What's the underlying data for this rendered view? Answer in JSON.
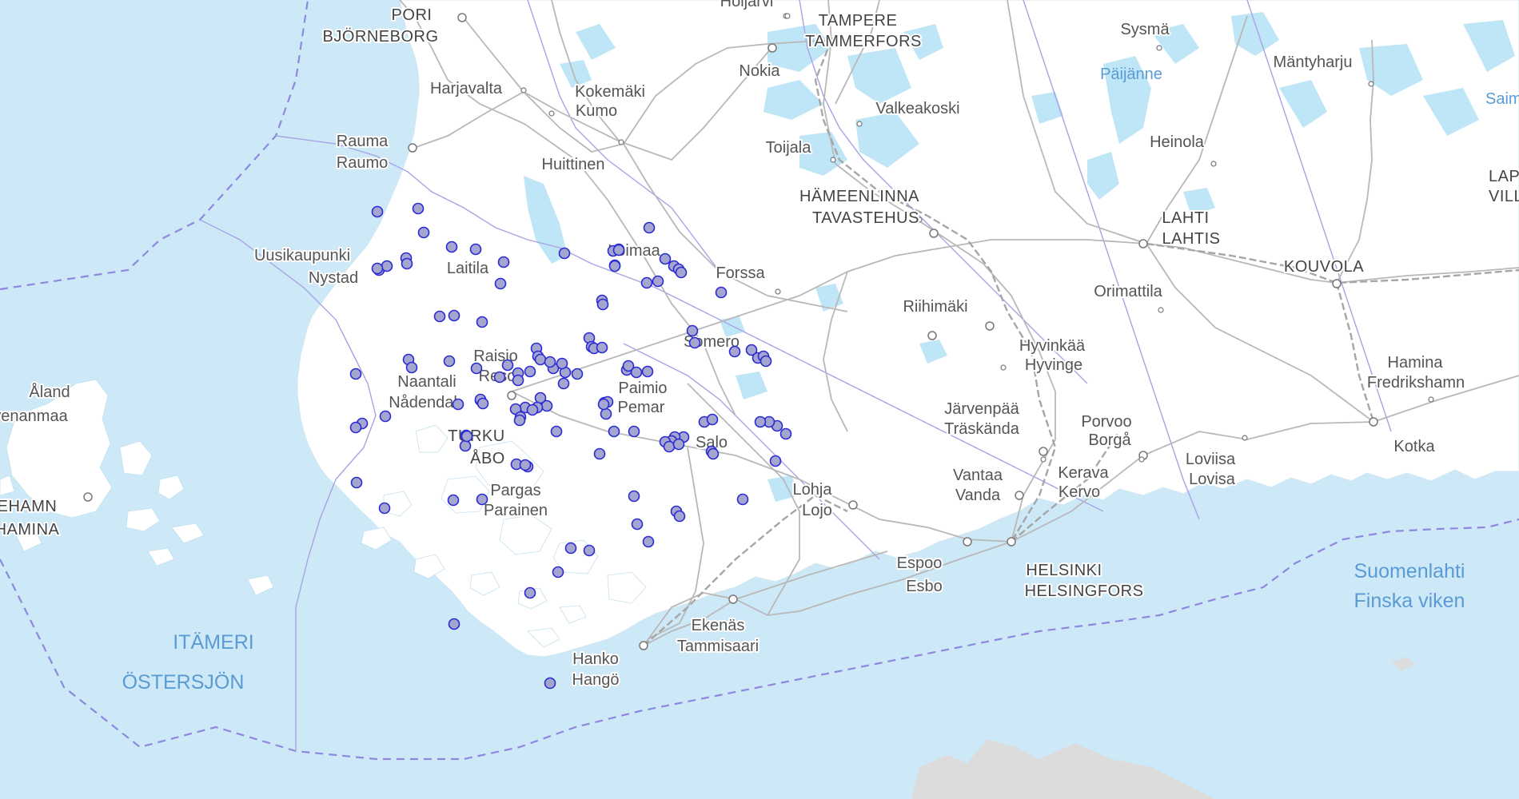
{
  "map": {
    "colors": {
      "sea": "#cde9f7",
      "land": "#ffffff",
      "lake": "#bfe6f7",
      "road": "#b8b8b8",
      "border": "#a9a2e3",
      "dash": "#8e87e0",
      "marker_fill": "#a4a6cf",
      "marker_stroke": "#2a2ad6",
      "foreign": "#dcdcdc"
    },
    "places": [
      {
        "key": "pori",
        "text": "PORI"
      },
      {
        "key": "bjorneborg",
        "text": "BJÖRNEBORG"
      },
      {
        "key": "harjavalta",
        "text": "Harjavalta"
      },
      {
        "key": "kokemaki",
        "text": "Kokemäki"
      },
      {
        "key": "kumo",
        "text": "Kumo"
      },
      {
        "key": "rauma",
        "text": "Rauma"
      },
      {
        "key": "raumo",
        "text": "Raumo"
      },
      {
        "key": "huittinen",
        "text": "Huittinen"
      },
      {
        "key": "uusikaupunki",
        "text": "Uusikaupunki"
      },
      {
        "key": "nystad",
        "text": "Nystad"
      },
      {
        "key": "laitila",
        "text": "Laitila"
      },
      {
        "key": "loimaa",
        "text": "Loimaa"
      },
      {
        "key": "forssa",
        "text": "Forssa"
      },
      {
        "key": "raisio",
        "text": "Raisio"
      },
      {
        "key": "reso",
        "text": "Reso"
      },
      {
        "key": "naantali",
        "text": "Naantali"
      },
      {
        "key": "nadendal",
        "text": "Nådendal"
      },
      {
        "key": "turku",
        "text": "TURKU"
      },
      {
        "key": "abo",
        "text": "ÅBO"
      },
      {
        "key": "paimio",
        "text": "Paimio"
      },
      {
        "key": "pemar",
        "text": "Pemar"
      },
      {
        "key": "somero",
        "text": "Somero"
      },
      {
        "key": "salo",
        "text": "Salo"
      },
      {
        "key": "pargas",
        "text": "Pargas"
      },
      {
        "key": "parainen",
        "text": "Parainen"
      },
      {
        "key": "aland",
        "text": "Åland"
      },
      {
        "key": "ahvenanmaa",
        "text": "venanmaa"
      },
      {
        "key": "mariehamn",
        "text": "EHAMN"
      },
      {
        "key": "maarianhamina",
        "text": "HAMINA"
      },
      {
        "key": "tampere",
        "text": "TAMPERE"
      },
      {
        "key": "tammerfors",
        "text": "TAMMERFORS"
      },
      {
        "key": "nokia",
        "text": "Nokia"
      },
      {
        "key": "valkeakoski",
        "text": "Valkeakoski"
      },
      {
        "key": "toijala",
        "text": "Toijala"
      },
      {
        "key": "hameenlinna",
        "text": "HÄMEENLINNA"
      },
      {
        "key": "tavastehus",
        "text": "TAVASTEHUS"
      },
      {
        "key": "riihimaki",
        "text": "Riihimäki"
      },
      {
        "key": "hyvinkaa",
        "text": "Hyvinkää"
      },
      {
        "key": "hyvinge",
        "text": "Hyvinge"
      },
      {
        "key": "jarvenpaa",
        "text": "Järvenpää"
      },
      {
        "key": "traskanda",
        "text": "Träskända"
      },
      {
        "key": "vantaa",
        "text": "Vantaa"
      },
      {
        "key": "vanda",
        "text": "Vanda"
      },
      {
        "key": "kerava",
        "text": "Kerava"
      },
      {
        "key": "kervo",
        "text": "Kervo"
      },
      {
        "key": "porvoo",
        "text": "Porvoo"
      },
      {
        "key": "borga",
        "text": "Borgå"
      },
      {
        "key": "loviisa",
        "text": "Loviisa"
      },
      {
        "key": "lovisa",
        "text": "Lovisa"
      },
      {
        "key": "lohja",
        "text": "Lohja"
      },
      {
        "key": "lojo",
        "text": "Lojo"
      },
      {
        "key": "espoo",
        "text": "Espoo"
      },
      {
        "key": "esbo",
        "text": "Esbo"
      },
      {
        "key": "helsinki",
        "text": "HELSINKI"
      },
      {
        "key": "helsingfors",
        "text": "HELSINGFORS"
      },
      {
        "key": "ekenas",
        "text": "Ekenäs"
      },
      {
        "key": "tammisaari",
        "text": "Tammisaari"
      },
      {
        "key": "hanko",
        "text": "Hanko"
      },
      {
        "key": "hango",
        "text": "Hangö"
      },
      {
        "key": "lahti",
        "text": "LAHTI"
      },
      {
        "key": "lahtis",
        "text": "LAHTIS"
      },
      {
        "key": "orimattila",
        "text": "Orimattila"
      },
      {
        "key": "kouvola",
        "text": "KOUVOLA"
      },
      {
        "key": "heinola",
        "text": "Heinola"
      },
      {
        "key": "sysma",
        "text": "Sysmä"
      },
      {
        "key": "mantyharju",
        "text": "Mäntyharju"
      },
      {
        "key": "lappeen",
        "text": "LAPPEEN"
      },
      {
        "key": "villmans",
        "text": "VILLMANS"
      },
      {
        "key": "hamina",
        "text": "Hamina"
      },
      {
        "key": "fredrikshamn",
        "text": "Fredrikshamn"
      },
      {
        "key": "kotka",
        "text": "Kotka"
      },
      {
        "key": "orivesi_top",
        "text": "Hoijärvi"
      }
    ],
    "water_labels": [
      {
        "key": "paijanne",
        "text": "Päijänne"
      },
      {
        "key": "saimaa",
        "text": "Saim"
      },
      {
        "key": "itameri",
        "text": "ITÄMERI"
      },
      {
        "key": "ostersjon",
        "text": "ÖSTERSJÖN"
      },
      {
        "key": "suomenlahti",
        "text": "Suomenlahti"
      },
      {
        "key": "finska",
        "text": "Finska viken"
      }
    ],
    "observation_count": 121
  }
}
